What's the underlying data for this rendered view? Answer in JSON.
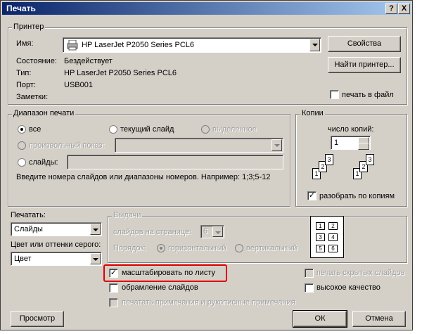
{
  "window": {
    "title": "Печать",
    "help_label": "?",
    "close_label": "X"
  },
  "printer": {
    "group_label": "Принтер",
    "name_label": "Имя:",
    "name_value": "HP LaserJet P2050 Series PCL6",
    "properties_button": "Свойства",
    "find_button": "Найти принтер...",
    "status_label": "Состояние:",
    "status_value": "Бездействует",
    "type_label": "Тип:",
    "type_value": "HP LaserJet P2050 Series PCL6",
    "port_label": "Порт:",
    "port_value": "USB001",
    "comments_label": "Заметки:",
    "print_to_file": "печать в файл"
  },
  "range": {
    "group_label": "Диапазон печати",
    "all": "все",
    "current": "текущий слайд",
    "selection": "выделенное",
    "custom_show": "произвольный показ:",
    "slides": "слайды:",
    "hint": "Введите номера слайдов или диапазоны номеров. Например: 1;3;5-12"
  },
  "copies": {
    "group_label": "Копии",
    "count_label": "число копий:",
    "count_value": "1",
    "collate": "разобрать по копиям",
    "pages": [
      "1",
      "2",
      "3"
    ]
  },
  "print_what": {
    "label": "Печатать:",
    "value": "Слайды"
  },
  "color": {
    "label": "Цвет или оттенки серого:",
    "value": "Цвет"
  },
  "handouts": {
    "group_label": "Выдачи",
    "per_page_label": "слайдов на странице:",
    "per_page_value": "6",
    "order_label": "Порядок:",
    "horizontal": "горизонтальный",
    "vertical": "вертикальный",
    "preview_cells": [
      "1",
      "2",
      "3",
      "4",
      "5",
      "6"
    ]
  },
  "options": {
    "scale": "масштабировать по листу",
    "frame": "обрамление слайдов",
    "comments": "печатать примечания и рукописные примечания",
    "hidden": "печать скрытых слайдов",
    "quality": "высокое качество"
  },
  "buttons": {
    "preview": "Просмотр",
    "ok": "ОК",
    "cancel": "Отмена"
  },
  "colors": {
    "highlight": "#e00000",
    "title_bar": "#0a246a",
    "dialog_bg": "#d4d0c8"
  }
}
